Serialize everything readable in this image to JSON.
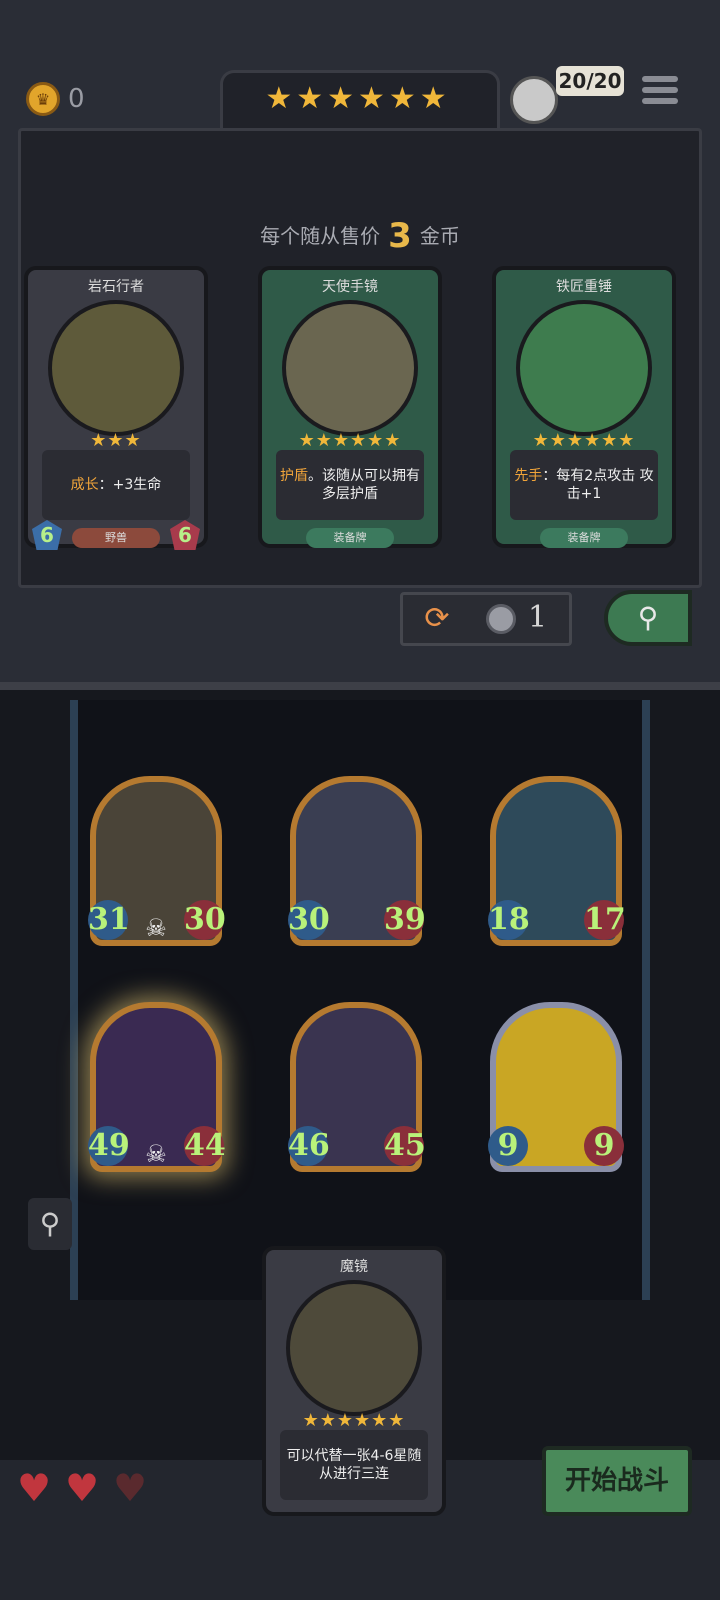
{
  "header": {
    "coins": "0",
    "shop_stars": "★★★★★★",
    "health": "20/20",
    "icons": {
      "coin": "crown-coin-icon",
      "menu": "hamburger-menu-icon",
      "avatar": "player-avatar"
    }
  },
  "shop": {
    "price_prefix": "每个随从售价",
    "price_value": "3",
    "price_suffix": "金币",
    "cards": [
      {
        "name": "岩石行者",
        "stars": "★★★",
        "desc_kw": "成长",
        "desc_rest": "：+3生命",
        "tag": "野兽",
        "atk": "6",
        "hp": "6",
        "type": "minion"
      },
      {
        "name": "天使手镜",
        "stars": "★★★★★★",
        "desc_kw": "护盾",
        "desc_rest": "。该随从可以拥有多层护盾",
        "tag": "装备牌",
        "type": "equip"
      },
      {
        "name": "铁匠重锤",
        "stars": "★★★★★★",
        "desc_kw": "先手",
        "desc_rest": "：每有2点攻击 攻击+1",
        "tag": "装备牌",
        "type": "equip"
      }
    ],
    "reroll_cost": "1"
  },
  "board": {
    "units": [
      {
        "atk": "31",
        "hp": "30",
        "skull": true,
        "frame": "bronze"
      },
      {
        "atk": "30",
        "hp": "39",
        "skull": false,
        "frame": "bronze"
      },
      {
        "atk": "18",
        "hp": "17",
        "skull": false,
        "frame": "bronze"
      },
      {
        "atk": "49",
        "hp": "44",
        "skull": true,
        "frame": "bronze",
        "glow": true
      },
      {
        "atk": "46",
        "hp": "45",
        "skull": false,
        "frame": "bronze"
      },
      {
        "atk": "9",
        "hp": "9",
        "skull": false,
        "frame": "silver"
      }
    ]
  },
  "hand_card": {
    "name": "魔镜",
    "stars": "★★★★★★",
    "desc": "可以代替一张4-6星随从进行三连"
  },
  "lives": {
    "filled": 2,
    "total": 3
  },
  "start_button": "开始战斗"
}
